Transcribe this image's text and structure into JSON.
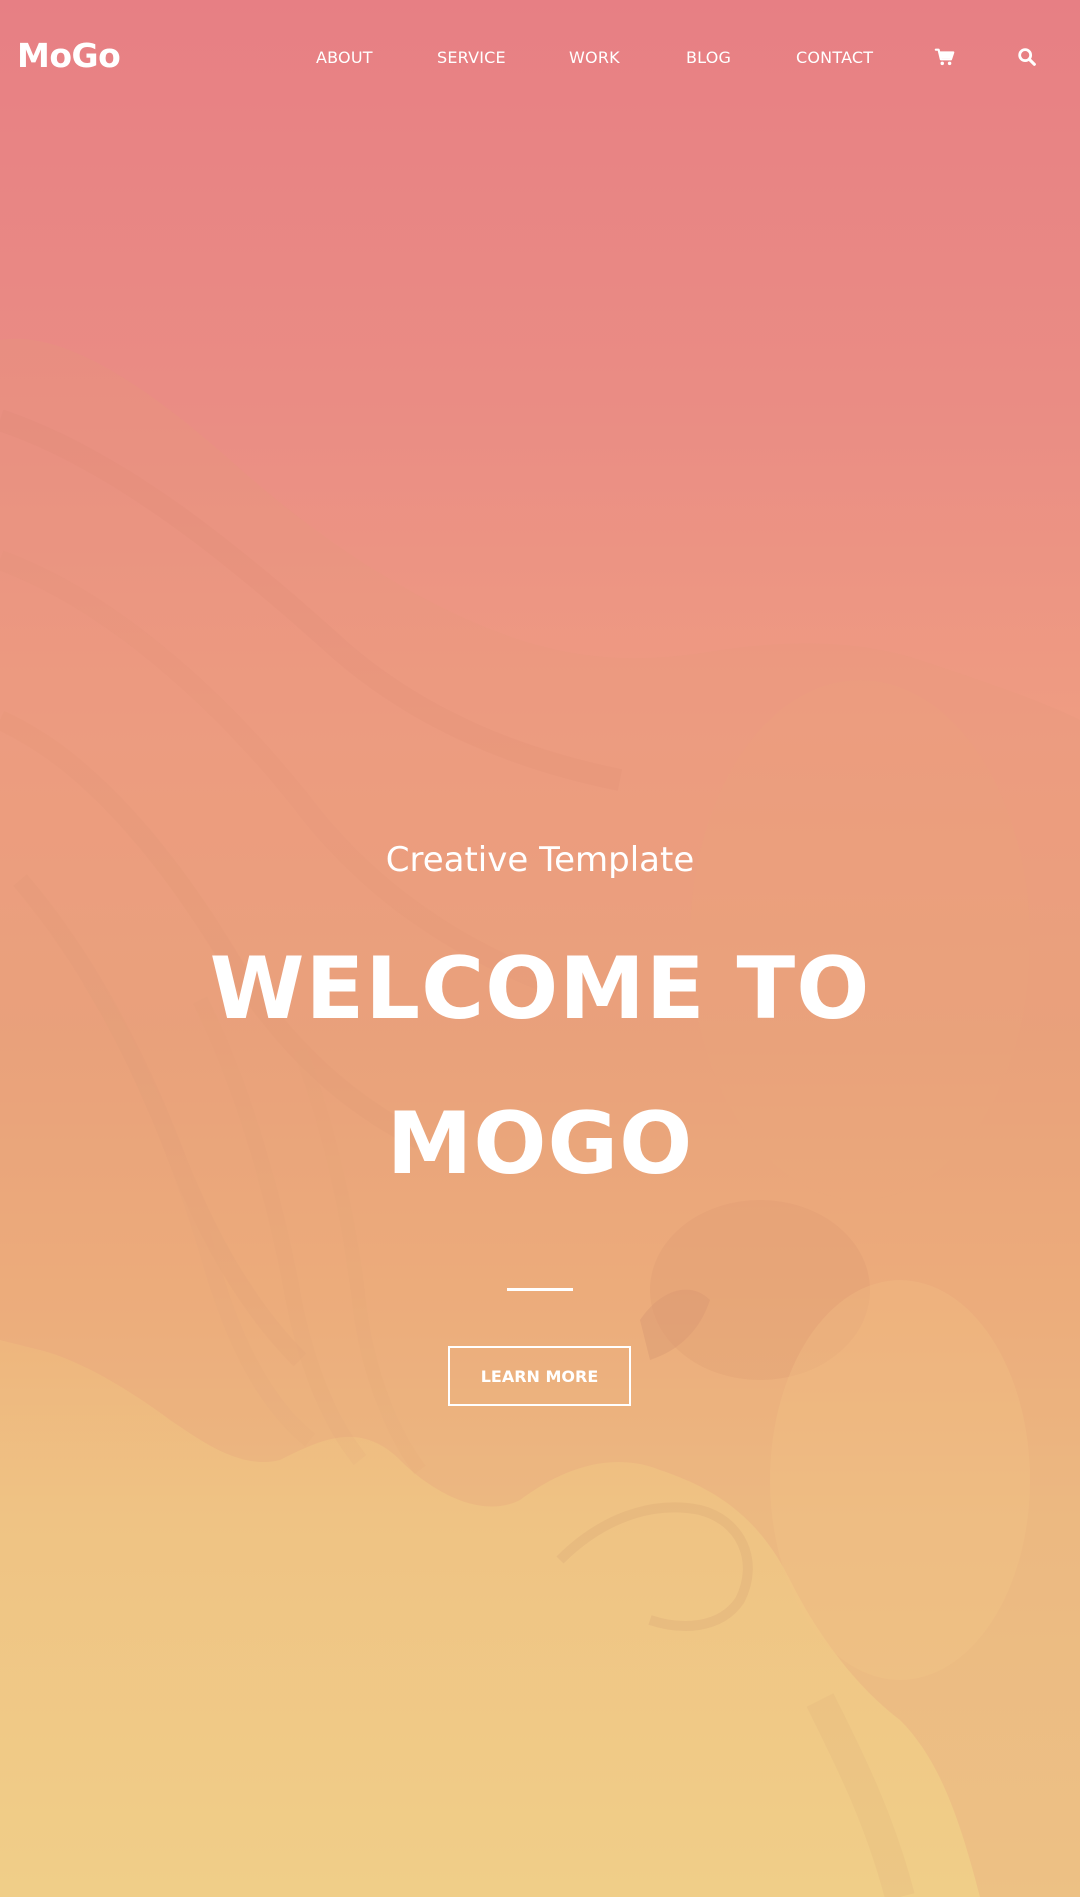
{
  "brand": {
    "logo_text": "MoGo"
  },
  "nav": {
    "items": [
      {
        "label": "ABOUT"
      },
      {
        "label": "SERVICE"
      },
      {
        "label": "WORK"
      },
      {
        "label": "BLOG"
      },
      {
        "label": "CONTACT"
      }
    ],
    "cart_icon": "shopping-cart-icon",
    "search_icon": "search-icon"
  },
  "hero": {
    "subtitle": "Creative Template",
    "title_line_1": "WELCOME TO",
    "title_line_2": "MOGO",
    "button_label": "LEARN MORE",
    "background_image": "eagle-photo",
    "overlay_gradient": [
      "#e77f84",
      "#f0ce88"
    ]
  }
}
